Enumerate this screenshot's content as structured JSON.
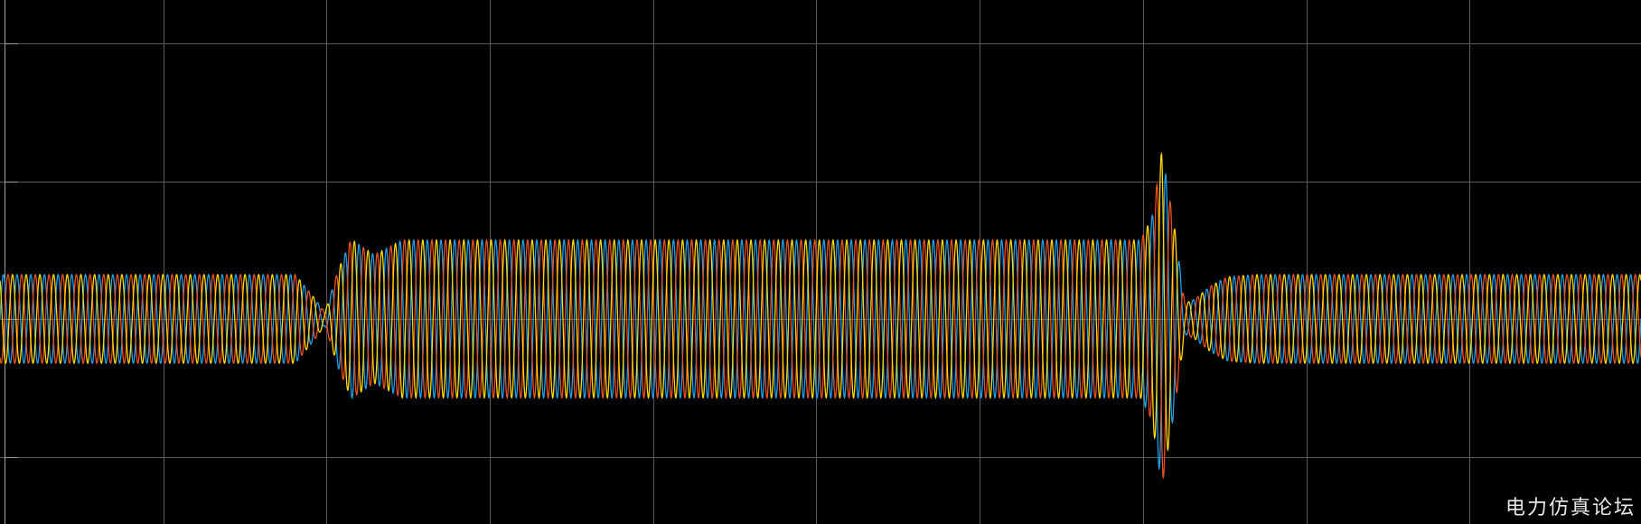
{
  "watermark": "电力仿真论坛",
  "colors": {
    "background": "#000000",
    "grid": "#5a5a5a",
    "axis": "#9a9a9a"
  },
  "chart_data": {
    "type": "line",
    "grid": true,
    "legend": "none",
    "axis_labels_visible": false,
    "series": [
      {
        "color": "#1f9fe8",
        "phase_deg": 0
      },
      {
        "color": "#e8501e",
        "phase_deg": 120
      },
      {
        "color": "#ffd800",
        "phase_deg": 240
      }
    ],
    "cycles": 120,
    "amplitude_envelope": [
      [
        0.0,
        1.0
      ],
      [
        0.18,
        1.0
      ],
      [
        0.19,
        0.55
      ],
      [
        0.198,
        0.15
      ],
      [
        0.206,
        1.1
      ],
      [
        0.214,
        1.8
      ],
      [
        0.228,
        1.45
      ],
      [
        0.245,
        1.78
      ],
      [
        0.26,
        1.78
      ],
      [
        0.695,
        1.78
      ],
      [
        0.702,
        2.3
      ],
      [
        0.708,
        3.8
      ],
      [
        0.716,
        2.0
      ],
      [
        0.722,
        0.35
      ],
      [
        0.728,
        0.45
      ],
      [
        0.738,
        0.75
      ],
      [
        0.748,
        0.95
      ],
      [
        0.765,
        1.0
      ],
      [
        1.0,
        1.0
      ]
    ]
  }
}
